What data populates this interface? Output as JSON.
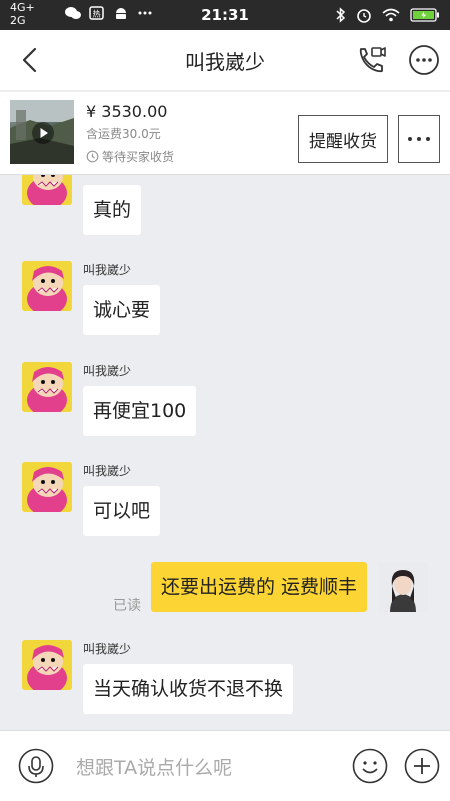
{
  "status_bar": {
    "network_top": "4G+",
    "network_bottom": "2G",
    "time": "21:31"
  },
  "nav": {
    "title": "叫我崴少",
    "back_icon": "chevron-left-icon",
    "call_icon": "phone-video-icon",
    "more_icon": "ellipsis-circle-icon"
  },
  "product": {
    "price": "¥ 3530.00",
    "shipping": "含运费30.0元",
    "status": "等待买家收货",
    "remind_label": "提醒收货",
    "thumb_icon": "play-icon"
  },
  "messages": [
    {
      "side": "left",
      "sender": "",
      "text": "真的"
    },
    {
      "side": "left",
      "sender": "叫我崴少",
      "text": "诚心要"
    },
    {
      "side": "left",
      "sender": "叫我崴少",
      "text": "再便宜100"
    },
    {
      "side": "left",
      "sender": "叫我崴少",
      "text": "可以吧"
    },
    {
      "side": "right",
      "sender": "",
      "text": "还要出运费的 运费顺丰",
      "read": "已读"
    },
    {
      "side": "left",
      "sender": "叫我崴少",
      "text": "当天确认收货不退不换"
    }
  ],
  "input": {
    "placeholder": "想跟TA说点什么呢"
  },
  "colors": {
    "my_bubble": "#fcd433",
    "background": "#ebedf0",
    "avatar_pink": "#e23f8d"
  }
}
